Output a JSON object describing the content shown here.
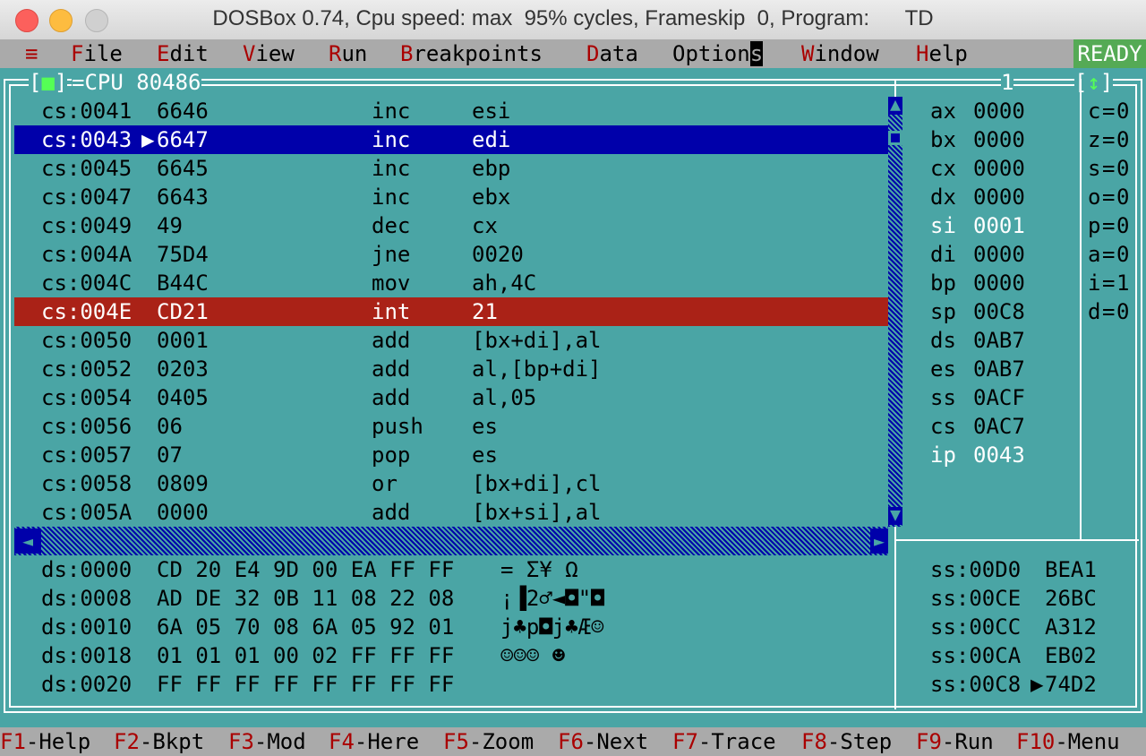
{
  "window": {
    "title": "DOSBox 0.74, Cpu speed: max  95% cycles, Frameskip  0, Program:      TD"
  },
  "menubar": {
    "system_menu": "≡",
    "items": [
      {
        "hotkey": "F",
        "rest": "ile"
      },
      {
        "hotkey": "E",
        "rest": "dit"
      },
      {
        "hotkey": "V",
        "rest": "iew"
      },
      {
        "hotkey": "R",
        "rest": "un"
      },
      {
        "hotkey": "B",
        "rest": "reakpoints"
      },
      {
        "hotkey": "D",
        "rest": "ata"
      },
      {
        "pre": "Option",
        "hotkey": "s",
        "rest": ""
      },
      {
        "hotkey": "W",
        "rest": "indow"
      },
      {
        "hotkey": "H",
        "rest": "elp"
      }
    ],
    "status": "READY"
  },
  "cpu_window": {
    "title": "CPU 80486",
    "window_number": "1",
    "zoom_icon": "↕",
    "close_icon": "■",
    "code_lines": [
      {
        "addr": "cs:0041",
        "bytes": "6646",
        "op": "inc",
        "args": "esi"
      },
      {
        "addr": "cs:0043",
        "bytes": "6647",
        "op": "inc",
        "args": "edi"
      },
      {
        "addr": "cs:0045",
        "bytes": "6645",
        "op": "inc",
        "args": "ebp"
      },
      {
        "addr": "cs:0047",
        "bytes": "6643",
        "op": "inc",
        "args": "ebx"
      },
      {
        "addr": "cs:0049",
        "bytes": "49",
        "op": "dec",
        "args": "cx"
      },
      {
        "addr": "cs:004A",
        "bytes": "75D4",
        "op": "jne",
        "args": "0020"
      },
      {
        "addr": "cs:004C",
        "bytes": "B44C",
        "op": "mov",
        "args": "ah,4C"
      },
      {
        "addr": "cs:004E",
        "bytes": "CD21",
        "op": "int",
        "args": "21"
      },
      {
        "addr": "cs:0050",
        "bytes": "0001",
        "op": "add",
        "args": "[bx+di],al"
      },
      {
        "addr": "cs:0052",
        "bytes": "0203",
        "op": "add",
        "args": "al,[bp+di]"
      },
      {
        "addr": "cs:0054",
        "bytes": "0405",
        "op": "add",
        "args": "al,05"
      },
      {
        "addr": "cs:0056",
        "bytes": "06",
        "op": "push",
        "args": "es"
      },
      {
        "addr": "cs:0057",
        "bytes": "07",
        "op": "pop",
        "args": "es"
      },
      {
        "addr": "cs:0058",
        "bytes": "0809",
        "op": "or",
        "args": "[bx+di],cl"
      },
      {
        "addr": "cs:005A",
        "bytes": "0000",
        "op": "add",
        "args": "[bx+si],al"
      }
    ],
    "current_marker": "▶",
    "registers": [
      {
        "name": "ax",
        "value": "0000"
      },
      {
        "name": "bx",
        "value": "0000"
      },
      {
        "name": "cx",
        "value": "0000"
      },
      {
        "name": "dx",
        "value": "0000"
      },
      {
        "name": "si",
        "value": "0001"
      },
      {
        "name": "di",
        "value": "0000"
      },
      {
        "name": "bp",
        "value": "0000"
      },
      {
        "name": "sp",
        "value": "00C8"
      },
      {
        "name": "ds",
        "value": "0AB7"
      },
      {
        "name": "es",
        "value": "0AB7"
      },
      {
        "name": "ss",
        "value": "0ACF"
      },
      {
        "name": "cs",
        "value": "0AC7"
      },
      {
        "name": "ip",
        "value": "0043"
      }
    ],
    "flags": [
      {
        "name": "c",
        "value": "0"
      },
      {
        "name": "z",
        "value": "0"
      },
      {
        "name": "s",
        "value": "0"
      },
      {
        "name": "o",
        "value": "0"
      },
      {
        "name": "p",
        "value": "0"
      },
      {
        "name": "a",
        "value": "0"
      },
      {
        "name": "i",
        "value": "1"
      },
      {
        "name": "d",
        "value": "0"
      }
    ],
    "dump_lines": [
      {
        "addr": "ds:0000",
        "bytes": "CD 20 E4 9D 00 EA FF FF",
        "ascii": "= Σ¥ Ω"
      },
      {
        "addr": "ds:0008",
        "bytes": "AD DE 32 0B 11 08 22 08",
        "ascii": "¡▐2♂◄◘\"◘"
      },
      {
        "addr": "ds:0010",
        "bytes": "6A 05 70 08 6A 05 92 01",
        "ascii": "j♣p◘j♣Æ☺"
      },
      {
        "addr": "ds:0018",
        "bytes": "01 01 01 00 02 FF FF FF",
        "ascii": "☺☺☺ ☻"
      },
      {
        "addr": "ds:0020",
        "bytes": "FF FF FF FF FF FF FF FF",
        "ascii": ""
      }
    ],
    "stack_lines": [
      {
        "addr": "ss:00D0",
        "value": "BEA1"
      },
      {
        "addr": "ss:00CE",
        "value": "26BC"
      },
      {
        "addr": "ss:00CC",
        "value": "A312"
      },
      {
        "addr": "ss:00CA",
        "value": "EB02"
      },
      {
        "addr": "ss:00C8",
        "value": "74D2"
      }
    ]
  },
  "fkeys": [
    {
      "key": "F1",
      "label": "-Help"
    },
    {
      "key": "F2",
      "label": "-Bkpt"
    },
    {
      "key": "F3",
      "label": "-Mod"
    },
    {
      "key": "F4",
      "label": "-Here"
    },
    {
      "key": "F5",
      "label": "-Zoom"
    },
    {
      "key": "F6",
      "label": "-Next"
    },
    {
      "key": "F7",
      "label": "-Trace"
    },
    {
      "key": "F8",
      "label": "-Step"
    },
    {
      "key": "F9",
      "label": "-Run"
    },
    {
      "key": "F10",
      "label": "-Menu"
    }
  ],
  "colors": {
    "background": "#4aa5a5",
    "current_line": "#0000aa",
    "breakpoint_line": "#aa2217",
    "menu_bar": "#aaaaaa",
    "hotkey": "#aa0000",
    "ready": "#55aa55"
  }
}
